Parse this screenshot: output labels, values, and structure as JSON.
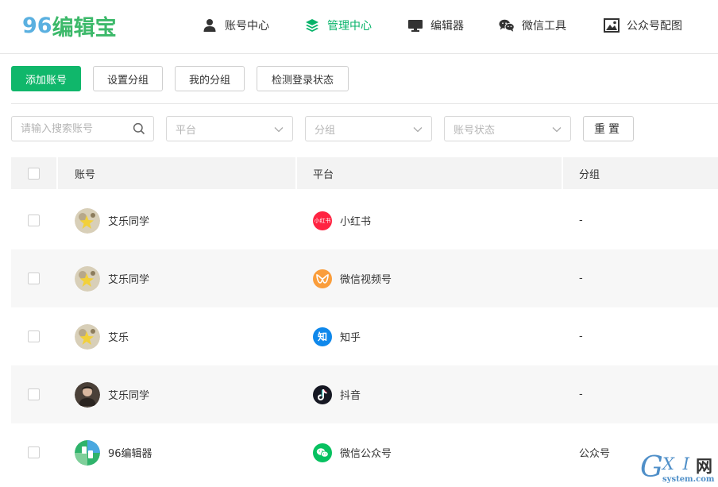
{
  "header": {
    "logo_number": "96",
    "logo_text": "编辑宝",
    "nav": [
      {
        "label": "账号中心",
        "icon": "user-icon",
        "active": false
      },
      {
        "label": "管理中心",
        "icon": "layers-icon",
        "active": true
      },
      {
        "label": "编辑器",
        "icon": "monitor-icon",
        "active": false
      },
      {
        "label": "微信工具",
        "icon": "wechat-icon",
        "active": false
      },
      {
        "label": "公众号配图",
        "icon": "image-icon",
        "active": false
      }
    ]
  },
  "toolbar": {
    "add_account": "添加账号",
    "set_group": "设置分组",
    "my_group": "我的分组",
    "check_login": "检测登录状态"
  },
  "filters": {
    "search_placeholder": "请输入搜索账号",
    "platform_placeholder": "平台",
    "group_placeholder": "分组",
    "status_placeholder": "账号状态",
    "reset_label": "重置"
  },
  "table": {
    "columns": [
      "账号",
      "平台",
      "分组"
    ],
    "rows": [
      {
        "account": "艾乐同学",
        "platform": "小红书",
        "platform_icon": "xiaohongshu-icon",
        "group": "-",
        "checked": false
      },
      {
        "account": "艾乐同学",
        "platform": "微信视频号",
        "platform_icon": "wechat-channels-icon",
        "group": "-",
        "checked": false
      },
      {
        "account": "艾乐",
        "platform": "知乎",
        "platform_icon": "zhihu-icon",
        "group": "-",
        "checked": false
      },
      {
        "account": "艾乐同学",
        "platform": "抖音",
        "platform_icon": "douyin-icon",
        "group": "-",
        "checked": false
      },
      {
        "account": "96编辑器",
        "platform": "微信公众号",
        "platform_icon": "wechat-official-icon",
        "group": "公众号",
        "checked": false
      }
    ]
  },
  "platform_badges": {
    "xiaohongshu": "小红书",
    "zhihu": "知"
  },
  "watermark": {
    "g": "G",
    "xi": "X I",
    "cn": "网",
    "domain": "system.com"
  },
  "colors": {
    "brand_green": "#10b76b",
    "nav_active": "#07b36a",
    "xiaohongshu": "#ff2442",
    "wechat_channels": "#fa9d3b",
    "zhihu": "#0f88eb",
    "douyin": "#161823",
    "wechat": "#07c160"
  }
}
